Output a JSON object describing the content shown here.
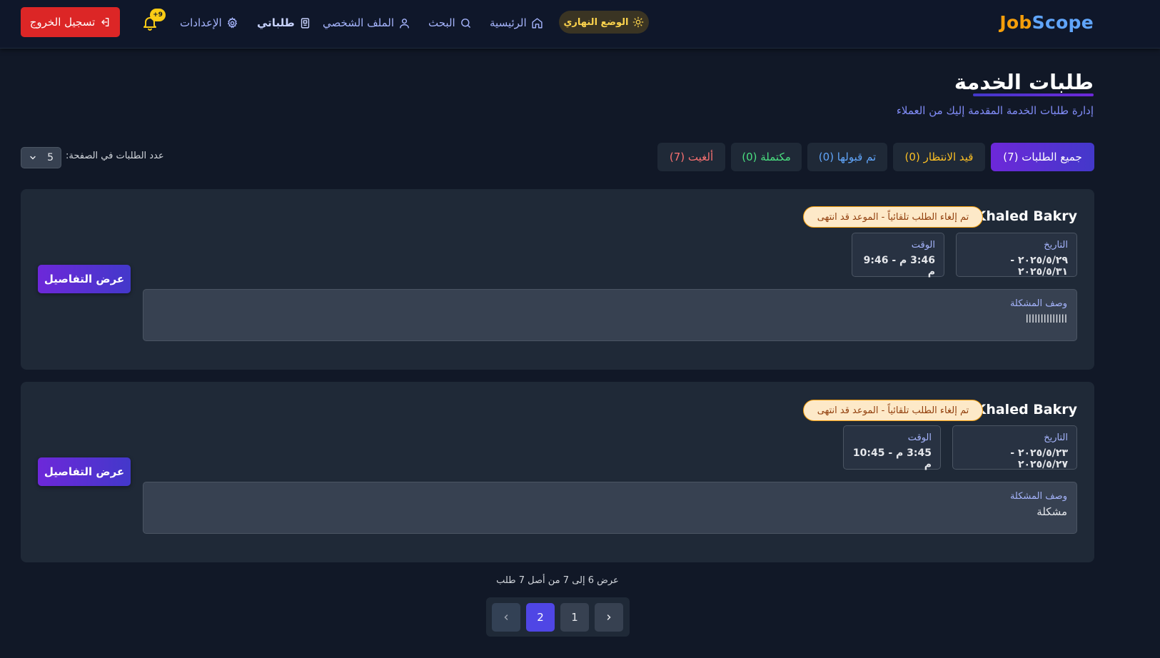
{
  "nav": {
    "brand_part1": "Job",
    "brand_part2": "Scope",
    "theme_toggle": "الوضع النهاري",
    "links": {
      "home": "الرئيسية",
      "search": "البحث",
      "profile": "الملف الشخصي",
      "my_requests": "طلباتي",
      "settings": "الإعدادات"
    },
    "notifications_badge": "+9",
    "logout": "تسجيل الخروج"
  },
  "header": {
    "title": "طلبات الخدمة",
    "subtitle": "إدارة طلبات الخدمة المقدمة إليك من العملاء"
  },
  "filters": {
    "all": "جميع الطلبات (7)",
    "pending": "قيد الانتظار (0)",
    "accepted": "تم قبولها (0)",
    "completed": "مكتملة (0)",
    "cancelled": "ألغيت (7)"
  },
  "per_page": {
    "label": "عدد الطلبات في الصفحة:",
    "value": "5"
  },
  "requests": [
    {
      "client_name": "Khaled Bakry",
      "status": "تم إلغاء الطلب تلقائياً - الموعد قد انتهى",
      "date_label": "التاريخ",
      "date_value": "٢٠٢٥/٥/٢٩ - ٢٠٢٥/٥/٣١",
      "time_label": "الوقت",
      "time_value": "3:46 م - 9:46 م",
      "desc_label": "وصف المشكلة",
      "desc_value": "llllllllllllll",
      "details_button": "عرض التفاصيل"
    },
    {
      "client_name": "Khaled Bakry",
      "status": "تم إلغاء الطلب تلقائياً - الموعد قد انتهى",
      "date_label": "التاريخ",
      "date_value": "٢٠٢٥/٥/٢٣ - ٢٠٢٥/٥/٢٧",
      "time_label": "الوقت",
      "time_value": "3:45 م - 10:45 م",
      "desc_label": "وصف المشكلة",
      "desc_value": "مشكلة",
      "details_button": "عرض التفاصيل"
    }
  ],
  "pagination": {
    "info": "عرض 6 إلى 7 من أصل 7 طلب",
    "pages": [
      "1",
      "2"
    ],
    "current": "2"
  },
  "colors": {
    "background": "#111827",
    "navbar": "#0f172a",
    "card": "#1f2937",
    "accent": "#4f46e5",
    "logout": "#dc2626",
    "pending": "#fbbf24",
    "accepted": "#60a5fa",
    "completed": "#4ade80",
    "cancelled": "#f87171"
  }
}
